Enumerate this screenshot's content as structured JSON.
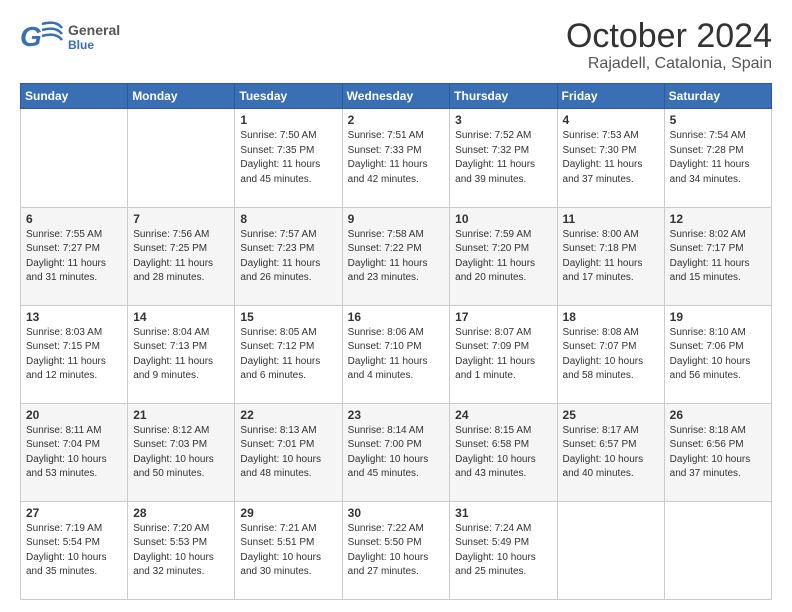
{
  "header": {
    "logo_g": "G",
    "logo_general": "General",
    "logo_blue": "Blue",
    "title": "October 2024",
    "subtitle": "Rajadell, Catalonia, Spain"
  },
  "weekdays": [
    "Sunday",
    "Monday",
    "Tuesday",
    "Wednesday",
    "Thursday",
    "Friday",
    "Saturday"
  ],
  "weeks": [
    [
      {
        "day": "",
        "info": ""
      },
      {
        "day": "",
        "info": ""
      },
      {
        "day": "1",
        "info": "Sunrise: 7:50 AM\nSunset: 7:35 PM\nDaylight: 11 hours and 45 minutes."
      },
      {
        "day": "2",
        "info": "Sunrise: 7:51 AM\nSunset: 7:33 PM\nDaylight: 11 hours and 42 minutes."
      },
      {
        "day": "3",
        "info": "Sunrise: 7:52 AM\nSunset: 7:32 PM\nDaylight: 11 hours and 39 minutes."
      },
      {
        "day": "4",
        "info": "Sunrise: 7:53 AM\nSunset: 7:30 PM\nDaylight: 11 hours and 37 minutes."
      },
      {
        "day": "5",
        "info": "Sunrise: 7:54 AM\nSunset: 7:28 PM\nDaylight: 11 hours and 34 minutes."
      }
    ],
    [
      {
        "day": "6",
        "info": "Sunrise: 7:55 AM\nSunset: 7:27 PM\nDaylight: 11 hours and 31 minutes."
      },
      {
        "day": "7",
        "info": "Sunrise: 7:56 AM\nSunset: 7:25 PM\nDaylight: 11 hours and 28 minutes."
      },
      {
        "day": "8",
        "info": "Sunrise: 7:57 AM\nSunset: 7:23 PM\nDaylight: 11 hours and 26 minutes."
      },
      {
        "day": "9",
        "info": "Sunrise: 7:58 AM\nSunset: 7:22 PM\nDaylight: 11 hours and 23 minutes."
      },
      {
        "day": "10",
        "info": "Sunrise: 7:59 AM\nSunset: 7:20 PM\nDaylight: 11 hours and 20 minutes."
      },
      {
        "day": "11",
        "info": "Sunrise: 8:00 AM\nSunset: 7:18 PM\nDaylight: 11 hours and 17 minutes."
      },
      {
        "day": "12",
        "info": "Sunrise: 8:02 AM\nSunset: 7:17 PM\nDaylight: 11 hours and 15 minutes."
      }
    ],
    [
      {
        "day": "13",
        "info": "Sunrise: 8:03 AM\nSunset: 7:15 PM\nDaylight: 11 hours and 12 minutes."
      },
      {
        "day": "14",
        "info": "Sunrise: 8:04 AM\nSunset: 7:13 PM\nDaylight: 11 hours and 9 minutes."
      },
      {
        "day": "15",
        "info": "Sunrise: 8:05 AM\nSunset: 7:12 PM\nDaylight: 11 hours and 6 minutes."
      },
      {
        "day": "16",
        "info": "Sunrise: 8:06 AM\nSunset: 7:10 PM\nDaylight: 11 hours and 4 minutes."
      },
      {
        "day": "17",
        "info": "Sunrise: 8:07 AM\nSunset: 7:09 PM\nDaylight: 11 hours and 1 minute."
      },
      {
        "day": "18",
        "info": "Sunrise: 8:08 AM\nSunset: 7:07 PM\nDaylight: 10 hours and 58 minutes."
      },
      {
        "day": "19",
        "info": "Sunrise: 8:10 AM\nSunset: 7:06 PM\nDaylight: 10 hours and 56 minutes."
      }
    ],
    [
      {
        "day": "20",
        "info": "Sunrise: 8:11 AM\nSunset: 7:04 PM\nDaylight: 10 hours and 53 minutes."
      },
      {
        "day": "21",
        "info": "Sunrise: 8:12 AM\nSunset: 7:03 PM\nDaylight: 10 hours and 50 minutes."
      },
      {
        "day": "22",
        "info": "Sunrise: 8:13 AM\nSunset: 7:01 PM\nDaylight: 10 hours and 48 minutes."
      },
      {
        "day": "23",
        "info": "Sunrise: 8:14 AM\nSunset: 7:00 PM\nDaylight: 10 hours and 45 minutes."
      },
      {
        "day": "24",
        "info": "Sunrise: 8:15 AM\nSunset: 6:58 PM\nDaylight: 10 hours and 43 minutes."
      },
      {
        "day": "25",
        "info": "Sunrise: 8:17 AM\nSunset: 6:57 PM\nDaylight: 10 hours and 40 minutes."
      },
      {
        "day": "26",
        "info": "Sunrise: 8:18 AM\nSunset: 6:56 PM\nDaylight: 10 hours and 37 minutes."
      }
    ],
    [
      {
        "day": "27",
        "info": "Sunrise: 7:19 AM\nSunset: 5:54 PM\nDaylight: 10 hours and 35 minutes."
      },
      {
        "day": "28",
        "info": "Sunrise: 7:20 AM\nSunset: 5:53 PM\nDaylight: 10 hours and 32 minutes."
      },
      {
        "day": "29",
        "info": "Sunrise: 7:21 AM\nSunset: 5:51 PM\nDaylight: 10 hours and 30 minutes."
      },
      {
        "day": "30",
        "info": "Sunrise: 7:22 AM\nSunset: 5:50 PM\nDaylight: 10 hours and 27 minutes."
      },
      {
        "day": "31",
        "info": "Sunrise: 7:24 AM\nSunset: 5:49 PM\nDaylight: 10 hours and 25 minutes."
      },
      {
        "day": "",
        "info": ""
      },
      {
        "day": "",
        "info": ""
      }
    ]
  ]
}
